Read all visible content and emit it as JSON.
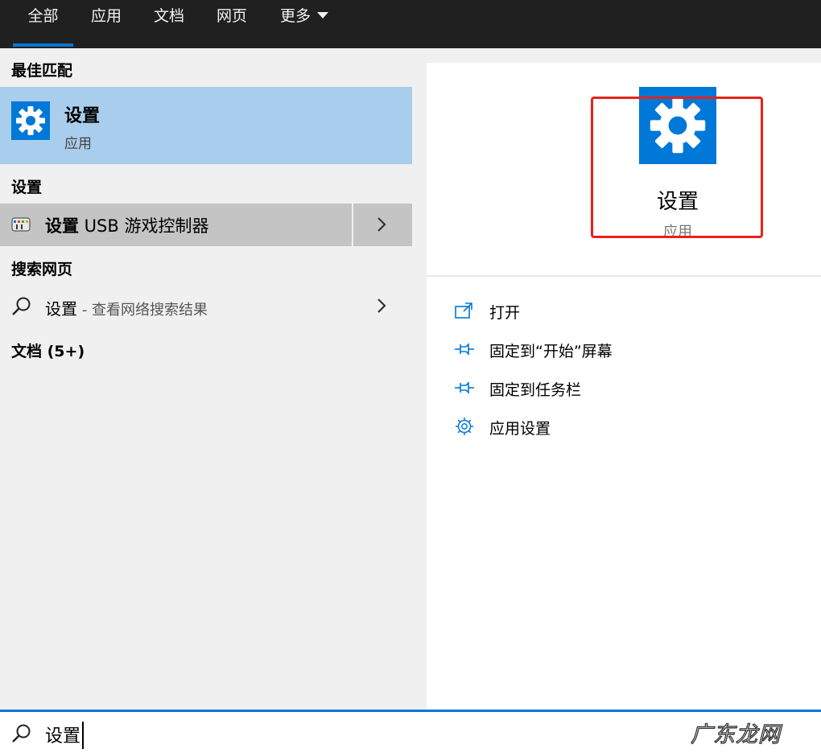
{
  "tabs": [
    {
      "label": "全部",
      "active": true
    },
    {
      "label": "应用",
      "active": false
    },
    {
      "label": "文档",
      "active": false
    },
    {
      "label": "网页",
      "active": false
    },
    {
      "label": "更多",
      "active": false
    }
  ],
  "left": {
    "best_match_title": "最佳匹配",
    "best_match": {
      "title": "设置",
      "subtitle": "应用"
    },
    "settings_section_title": "设置",
    "usb_item": {
      "bold": "设置",
      "rest": " USB 游戏控制器"
    },
    "web_section_title": "搜索网页",
    "web_item": {
      "label": "设置",
      "suffix": " - 查看网络搜索结果"
    },
    "docs_section_title": "文档 (5+)"
  },
  "right": {
    "app_title": "设置",
    "app_subtitle": "应用",
    "actions": [
      {
        "label": "打开",
        "icon": "open-icon"
      },
      {
        "label": "固定到“开始”屏幕",
        "icon": "pin-icon"
      },
      {
        "label": "固定到任务栏",
        "icon": "pin-icon"
      },
      {
        "label": "应用设置",
        "icon": "gear-icon"
      }
    ]
  },
  "search": {
    "value": "设置"
  },
  "watermark": "广东龙网",
  "colors": {
    "accent": "#0078d7",
    "selection": "#a9cdec",
    "highlight_box": "#e5231b",
    "tabbar": "#202020"
  }
}
